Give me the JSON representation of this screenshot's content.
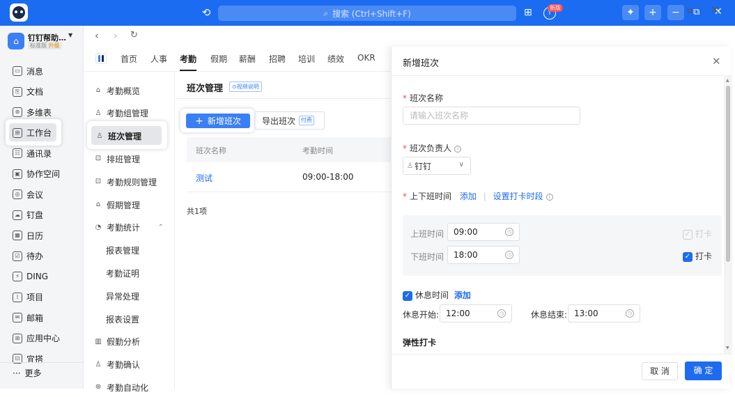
{
  "titlebar": {
    "search_placeholder": "搜索 (Ctrl+Shift+F)",
    "new_badge": "新版"
  },
  "org": {
    "name": "钉钉帮助…",
    "plan": "标准版",
    "upgrade": "升级"
  },
  "rail": {
    "items": [
      "消息",
      "文档",
      "多维表",
      "工作台",
      "通讯录",
      "协作空间",
      "会议",
      "钉盘",
      "日历",
      "待办",
      "DING",
      "项目",
      "邮箱",
      "应用中心",
      "宜搭"
    ],
    "more": "更多"
  },
  "tabs": [
    "首页",
    "人事",
    "考勤",
    "假期",
    "薪酬",
    "招聘",
    "培训",
    "绩效",
    "OKR"
  ],
  "submenu": {
    "items": [
      "考勤概览",
      "考勤组管理",
      "班次管理",
      "排班管理",
      "考勤规则管理",
      "假期管理",
      "考勤统计",
      "报表管理",
      "考勤证明",
      "异常处理",
      "报表设置",
      "假勤分析",
      "考勤确认",
      "考勤自动化"
    ]
  },
  "content": {
    "title": "班次管理",
    "video_tag": "⊙视频说明",
    "add_button": "新增班次",
    "export_button": "导出班次",
    "paid_badge": "付费",
    "columns": [
      "班次名称",
      "考勤时间"
    ],
    "rows": [
      {
        "name": "测试",
        "time": "09:00-18:00"
      }
    ],
    "total": "共1项"
  },
  "drawer": {
    "title": "新增班次",
    "name_label": "班次名称",
    "name_placeholder": "请输入班次名称",
    "owner_label": "班次负责人",
    "owner_value": "钉钉",
    "worktime_label": "上下班时间",
    "add_link": "添加",
    "set_clock_link": "设置打卡时段",
    "on_label": "上班时间",
    "on_value": "09:00",
    "off_label": "下班时间",
    "off_value": "18:00",
    "clock_label": "打卡",
    "rest_label": "休息时间",
    "rest_add": "添加",
    "rest_start_label": "休息开始:",
    "rest_start_value": "12:00",
    "rest_end_label": "休息结束:",
    "rest_end_value": "13:00",
    "flex_label": "弹性打卡",
    "cancel": "取 消",
    "confirm": "确 定"
  },
  "colors": {
    "brand": "#1c6cf2",
    "link": "#1e6bf0",
    "required": "#f54a45"
  }
}
